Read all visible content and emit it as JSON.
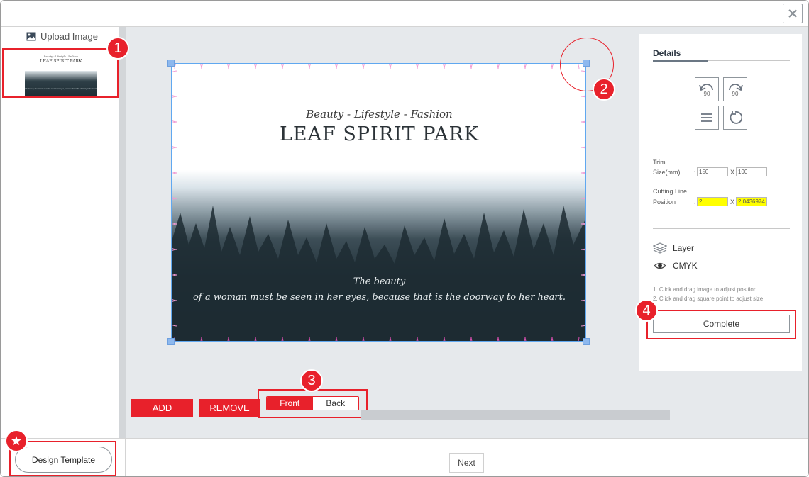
{
  "window": {
    "close_icon": "close-icon"
  },
  "left_panel": {
    "upload_label": "Upload Image",
    "thumbnail": {
      "subtitle": "Beauty - Lifestyle - Fashion",
      "title": "LEAF SPIRIT PARK",
      "quote_line1": "The beauty",
      "quote_line2": "of a woman must be seen in her eyes, because that is the doorway to her heart."
    }
  },
  "design": {
    "subtitle": "Beauty - Lifestyle - Fashion",
    "title": "LEAF SPIRIT PARK",
    "quote_line1": "The beauty",
    "quote_line2": "of a woman must be seen in her eyes, because that is the doorway to her heart."
  },
  "actions": {
    "add_label": "ADD",
    "remove_label": "REMOVE"
  },
  "side_toggle": {
    "front_label": "Front",
    "back_label": "Back",
    "selected": "Front"
  },
  "details": {
    "title": "Details",
    "rotate_left_label": "90",
    "rotate_right_label": "90",
    "trim_label_1": "Trim",
    "trim_label_2": "Size(mm)",
    "trim_width": "150",
    "trim_height": "100",
    "cutting_label_1": "Cutting Line",
    "cutting_label_2": "Position",
    "cutting_x": "2",
    "cutting_y": "2.0436974",
    "separator": ":",
    "times": "X",
    "layer_label": "Layer",
    "cmyk_label": "CMYK",
    "hint_1": "1. Click and drag image to adjust position",
    "hint_2": "2. Click and drag square point to adjust size",
    "complete_label": "Complete"
  },
  "bottom": {
    "design_template_label": "Design Template",
    "next_label": "Next"
  },
  "callouts": {
    "one": "1",
    "two": "2",
    "three": "3",
    "four": "4",
    "star": "★"
  },
  "colors": {
    "accent": "#e8212b",
    "highlight": "#ffff00",
    "selection": "#60a8f0"
  }
}
